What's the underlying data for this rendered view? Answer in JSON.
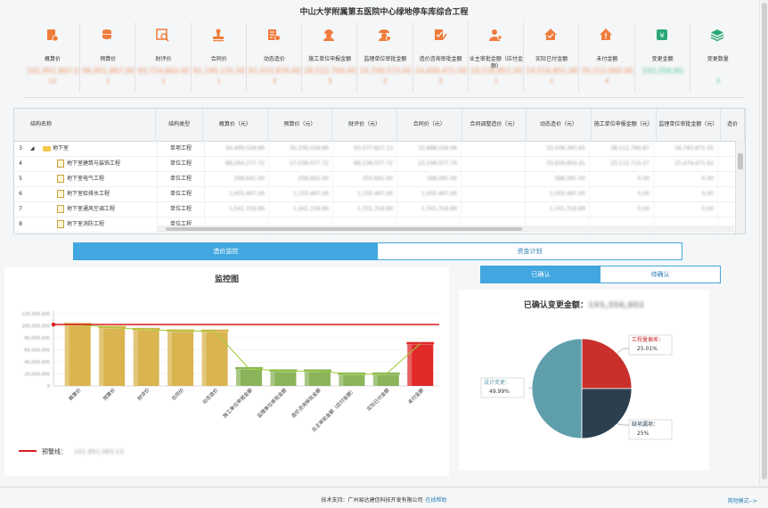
{
  "page_title": "中山大学附属第五医院中心绿地停车库综合工程",
  "kpis": [
    {
      "label": "概算价",
      "value": "101,951,867.00",
      "count": "12",
      "icon": "budget-doc-icon",
      "green": false
    },
    {
      "label": "预算价",
      "value": "96,951,867.00",
      "count": "1",
      "icon": "coin-stack-icon",
      "green": false
    },
    {
      "label": "财评价",
      "value": "93,714,663.00",
      "count": "1",
      "icon": "review-doc-icon",
      "green": false
    },
    {
      "label": "合同价",
      "value": "91,195,131.00",
      "count": "1",
      "icon": "stamp-icon",
      "green": false
    },
    {
      "label": "动态造价",
      "value": "91,023,876.00",
      "count": "3",
      "icon": "ledger-icon",
      "green": false
    },
    {
      "label": "施工单位申报金额",
      "value": "28,522,700.00",
      "count": "3",
      "icon": "worker-icon",
      "green": false
    },
    {
      "label": "监理单位审批金额",
      "value": "24,700,573.00",
      "count": "2",
      "icon": "supervisor-icon",
      "green": false
    },
    {
      "label": "造价咨询审批金额",
      "value": "24,650,471.00",
      "count": "2",
      "icon": "approve-doc-icon",
      "green": false
    },
    {
      "label": "业主审批金额（应付金额）",
      "value": "19,516,851.00",
      "count": "1",
      "icon": "owner-icon",
      "green": false
    },
    {
      "label": "实际已付金额",
      "value": "19,516,851.00",
      "count": "1",
      "icon": "house-check-icon",
      "green": false
    },
    {
      "label": "未付金额",
      "value": "70,212,000.00",
      "count": "4",
      "icon": "house-alert-icon",
      "green": false
    },
    {
      "label": "变更金额",
      "value": "193,356,80",
      "count": "",
      "icon": "money-card-icon",
      "green": true
    },
    {
      "label": "变更数量",
      "value": "",
      "count": "3",
      "icon": "layers-icon",
      "green": true
    }
  ],
  "grid": {
    "columns": [
      "结构名称",
      "结构类型",
      "概算价（元）",
      "预算价（元）",
      "财评价（元）",
      "合同价（元）",
      "合同调整造价（元）",
      "动态造价（元）",
      "施工单位申报金额（元）",
      "监理单位审批金额（元）",
      "造价"
    ],
    "rows": [
      {
        "no": "3",
        "name": "地下室",
        "type": "单项工程",
        "folder": true,
        "vals": [
          "94,499,528.89",
          "35,336,026.89",
          "93,577,827.13",
          "32,888,028.99",
          "",
          "33,508,383.65",
          "38,112,760.87",
          "18,783,871.55"
        ]
      },
      {
        "no": "4",
        "name": "地下室建筑与装饰工程",
        "type": "单位工程",
        "folder": false,
        "vals": [
          "88,264,277.72",
          "27,038,077.72",
          "89,238,077.72",
          "23,108,077.76",
          "",
          "33,656,854.41",
          "23,112,714.27",
          "15,474,471.62"
        ]
      },
      {
        "no": "5",
        "name": "地下室电气工程",
        "type": "单位工程",
        "folder": false,
        "vals": [
          "298,641.00",
          "258,661.00",
          "353,641.00",
          "188,081.00",
          "",
          "588,081.00",
          "0.00",
          "0.00"
        ]
      },
      {
        "no": "6",
        "name": "地下室给排水工程",
        "type": "单位工程",
        "folder": false,
        "vals": [
          "1,055,467.00",
          "1,155,467.00",
          "1,155,467.00",
          "1,055,467.00",
          "",
          "1,055,467.00",
          "0.00",
          "0.00"
        ]
      },
      {
        "no": "7",
        "name": "地下室通风空调工程",
        "type": "单位工程",
        "folder": false,
        "vals": [
          "1,541,318.89",
          "1,441,318.89",
          "1,331,318.89",
          "1,341,318.89",
          "",
          "1,341,318.89",
          "0.00",
          "0.00"
        ]
      },
      {
        "no": "8",
        "name": "地下室消防工程",
        "type": "单位工程",
        "folder": false,
        "vals": [
          "",
          "",
          "",
          "",
          "",
          "",
          "",
          ""
        ]
      }
    ]
  },
  "tabs": [
    "造价监控",
    "资金计划"
  ],
  "confirm_tabs": [
    "已确认",
    "待确认"
  ],
  "bar_chart_title": "监控图",
  "warning_label": "预警线：",
  "warning_value": "101,951,083.13",
  "pie_title": "已确认变更金额：",
  "pie_total": "193,356,802",
  "footer": {
    "text": "技术支持：广州易达建信科技开发有限公司",
    "help": "在线帮助",
    "right": "简短模式-->"
  },
  "chart_data": [
    {
      "type": "bar",
      "title": "监控图",
      "categories": [
        "概算价",
        "预算价",
        "财评价",
        "合同价",
        "动态造价",
        "施工单位申报金额",
        "监理单位审批金额",
        "造价咨询审批金额",
        "业主审批金额（应付金额）",
        "实际已付金额",
        "未付金额"
      ],
      "values": [
        101951867,
        96951867,
        93714663,
        91195131,
        91023876,
        28522700,
        24700573,
        24650471,
        19516851,
        19516851,
        70212000
      ],
      "colors": [
        "#d9b44f",
        "#d9b44f",
        "#d9b44f",
        "#d9b44f",
        "#d9b44f",
        "#8ab35a",
        "#8ab35a",
        "#8ab35a",
        "#8ab35a",
        "#8ab35a",
        "#e02a2a"
      ],
      "warning_line": 101951083,
      "ylim": [
        0,
        120000000
      ],
      "yticks": [
        "0",
        "20,000,000",
        "40,000,000",
        "60,000,000",
        "80,000,000",
        "100,000,000",
        "120,000,000"
      ],
      "legend": "预警线：101,951,083.13"
    },
    {
      "type": "pie",
      "title": "已确认变更金额：",
      "slices": [
        {
          "label": "工程量偏差：",
          "percent": 25.01,
          "display": "25.01%",
          "color": "#c9302c"
        },
        {
          "label": "缺项漏项：",
          "percent": 25.0,
          "display": "25%",
          "color": "#2b3f4f"
        },
        {
          "label": "设计变更：",
          "percent": 49.99,
          "display": "49.99%",
          "color": "#5f9fac"
        }
      ]
    }
  ]
}
